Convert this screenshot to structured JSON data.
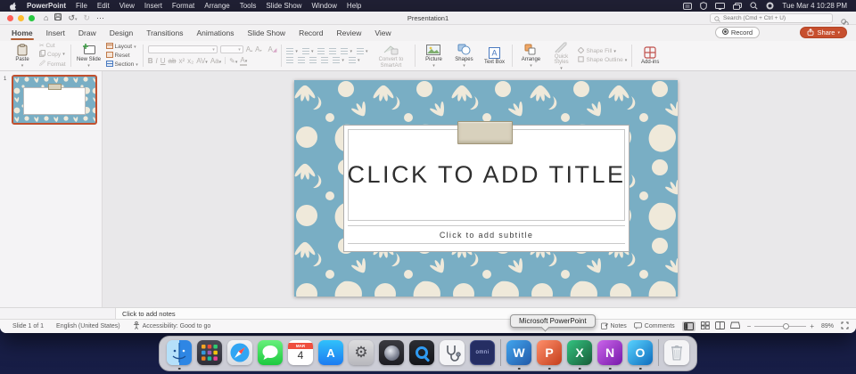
{
  "menubar": {
    "items": [
      "PowerPoint",
      "File",
      "Edit",
      "View",
      "Insert",
      "Format",
      "Arrange",
      "Tools",
      "Slide Show",
      "Window",
      "Help"
    ],
    "clock": "Tue Mar 4  10:28 PM"
  },
  "titlebar": {
    "title": "Presentation1",
    "search_placeholder": "Search (Cmd + Ctrl + U)"
  },
  "tabs": [
    "Home",
    "Insert",
    "Draw",
    "Design",
    "Transitions",
    "Animations",
    "Slide Show",
    "Record",
    "Review",
    "View"
  ],
  "actions": {
    "record": "Record",
    "share": "Share"
  },
  "ribbon": {
    "paste": "Paste",
    "cut": "Cut",
    "copy": "Copy",
    "format": "Format",
    "new_slide": "New Slide",
    "layout": "Layout",
    "reset": "Reset",
    "section": "Section",
    "bold": "B",
    "italic": "I",
    "underline": "U",
    "strike": "ab",
    "superscript": "x²",
    "subscript": "x₂",
    "spacing": "AV",
    "case": "Aa",
    "font_grow": "A",
    "font_shrink": "A",
    "clear_format": "A",
    "convert_smartart": "Convert to SmartArt",
    "picture": "Picture",
    "shapes": "Shapes",
    "textbox": "Text Box",
    "arrange": "Arrange",
    "quick_styles": "Quick Styles",
    "shape_fill": "Shape Fill",
    "shape_outline": "Shape Outline",
    "addins": "Add-ins"
  },
  "slides_panel": {
    "slide_number": "1"
  },
  "slide": {
    "title_placeholder": "CLICK TO ADD TITLE",
    "subtitle_placeholder": "Click to add subtitle"
  },
  "notes_placeholder": "Click to add notes",
  "statusbar": {
    "slide_count": "Slide 1 of 1",
    "language": "English (United States)",
    "accessibility": "Accessibility: Good to go",
    "notes": "Notes",
    "comments": "Comments",
    "zoom_level": "89%"
  },
  "tooltip": "Microsoft PowerPoint",
  "dock": {
    "calendar_month": "MAR",
    "calendar_day": "4",
    "appstore_letter": "A",
    "omni_label": "omni",
    "word_letter": "W",
    "powerpoint_letter": "P",
    "excel_letter": "X",
    "onenote_letter": "N",
    "outlook_letter": "O"
  },
  "colors": {
    "share_accent": "#c74f2e",
    "tab_underline": "#b35e34",
    "slide_teal": "#79aec4",
    "slide_cream": "#efe9da",
    "selection_border": "#c0502f"
  }
}
